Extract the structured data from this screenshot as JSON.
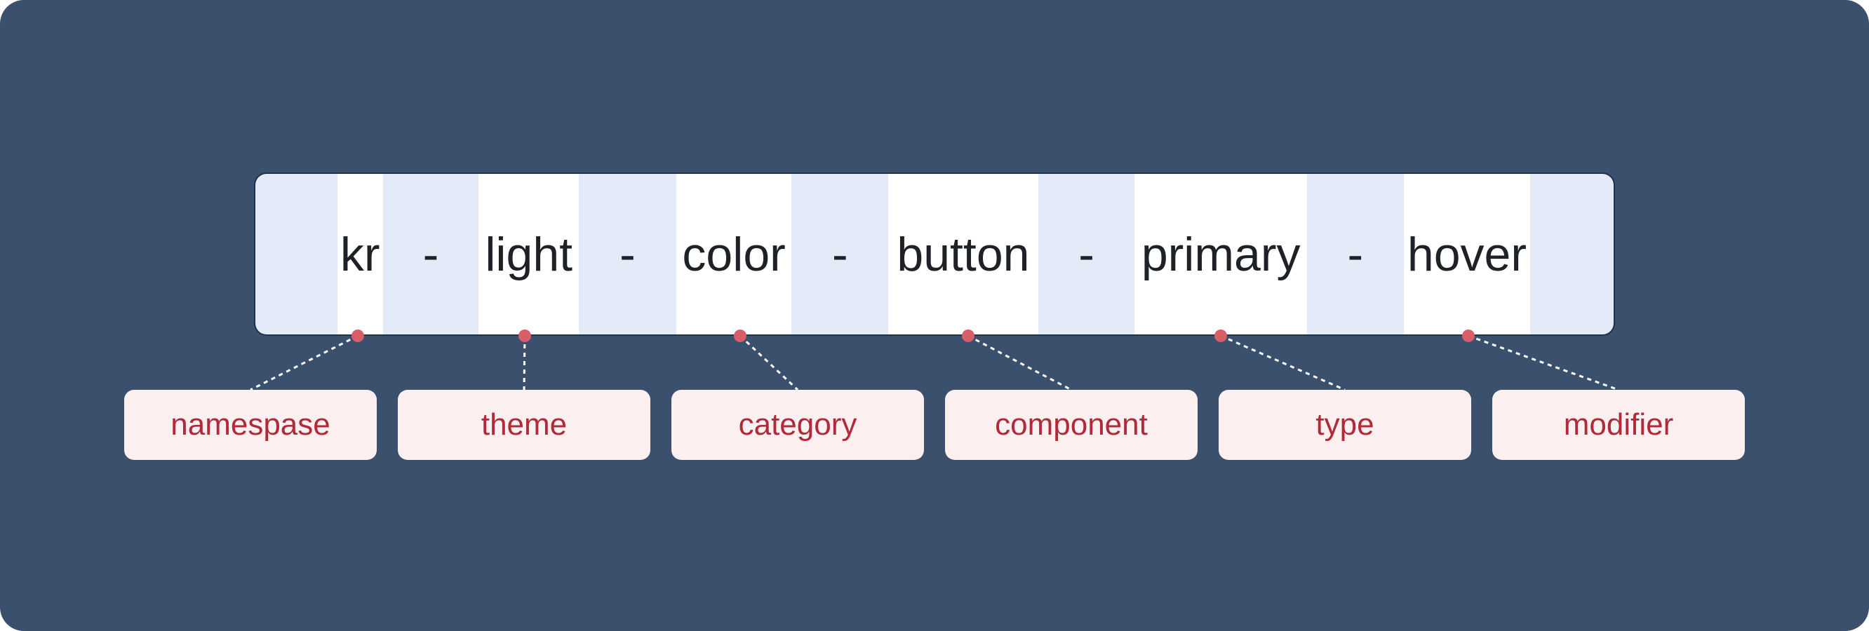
{
  "colors": {
    "background": "#3a506d",
    "segment_alt": "#e4ebf8",
    "segment_word": "#ffffff",
    "dot": "#d75d68",
    "label_bg": "#fbeff0",
    "label_text": "#b02a3a"
  },
  "token": {
    "parts": [
      "kr",
      "-",
      "light",
      "-",
      "color",
      "-",
      "button",
      "-",
      "primary",
      "-",
      "hover"
    ]
  },
  "labels": [
    "namespase",
    "theme",
    "category",
    "component",
    "type",
    "modifier"
  ]
}
